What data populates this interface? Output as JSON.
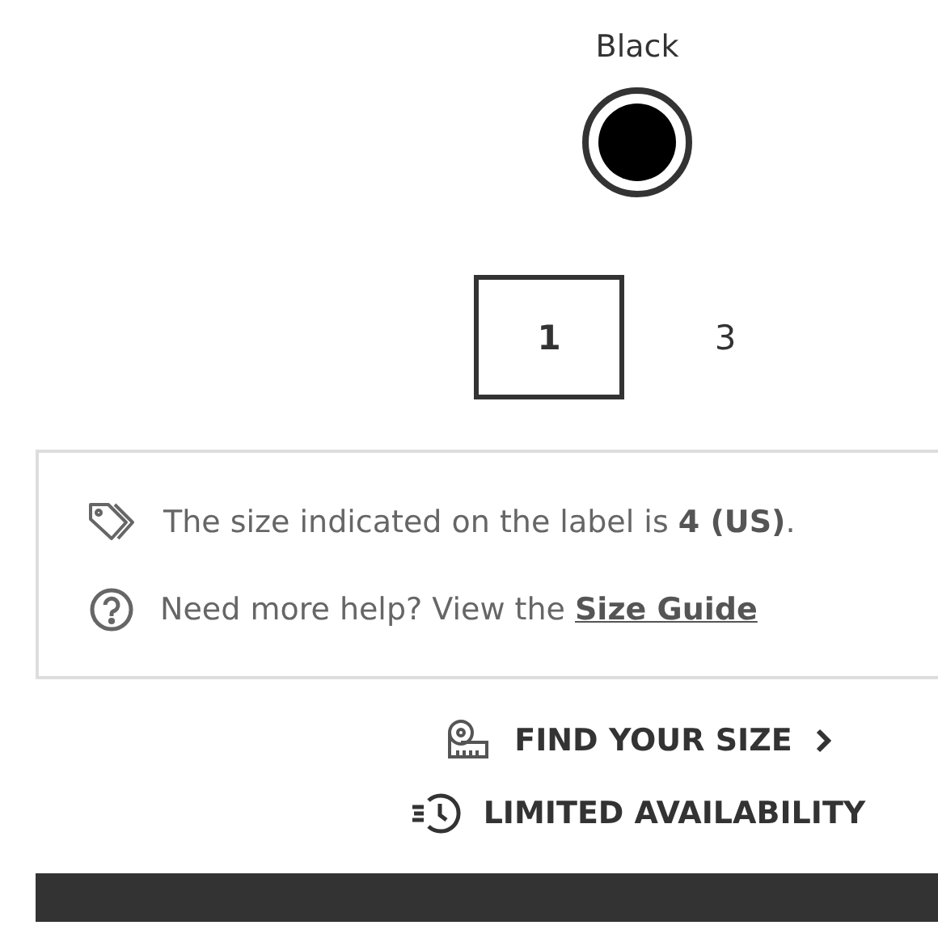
{
  "color": {
    "label": "Black",
    "swatches": [
      {
        "color": "#000000",
        "selected": true
      }
    ]
  },
  "sizes": [
    {
      "label": "1",
      "selected": true
    },
    {
      "label": "3",
      "selected": false
    }
  ],
  "info": {
    "label_line": "The size indicated on the label is  **4 (US)**.",
    "help_text": "Need more help? View the ",
    "help_link": "Size Guide"
  },
  "actions": [
    {
      "kind": "measure",
      "label": "FIND YOUR SIZE",
      "chevron": true
    },
    {
      "kind": "clock",
      "label": "LIMITED AVAILABILITY",
      "chevron": false
    }
  ]
}
